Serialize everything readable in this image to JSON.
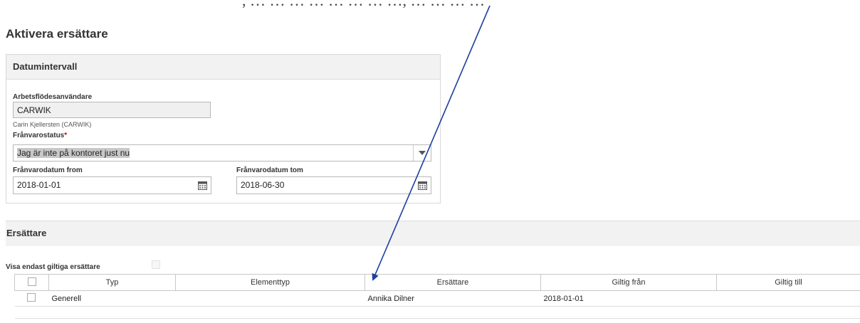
{
  "page": {
    "clipped_top_text": ", … … … … … … … …, …   … … …",
    "title": "Aktivera ersättare"
  },
  "datumintervall": {
    "header": "Datumintervall",
    "workflow_user_label": "Arbetsflödesanvändare",
    "workflow_user_value": "CARWIK",
    "workflow_user_name": "Carin Kjellersten (CARWIK)",
    "absence_status_label": "Frånvarostatus",
    "absence_status_required": "*",
    "absence_status_value": "Jag är inte på kontoret just nu",
    "date_from_label": "Frånvarodatum from",
    "date_from_value": "2018-01-01",
    "date_to_label": "Frånvarodatum tom",
    "date_to_value": "2018-06-30"
  },
  "ersattare": {
    "header": "Ersättare",
    "only_valid_label": "Visa endast giltiga ersättare",
    "columns": [
      "Typ",
      "Elementtyp",
      "Ersättare",
      "Giltig från",
      "Giltig till"
    ],
    "rows": [
      {
        "typ": "Generell",
        "elementtyp": "",
        "ersattare": "Annika Dilner",
        "giltig_fran": "2018-01-01",
        "giltig_till": ""
      }
    ]
  },
  "annotation": {
    "color": "#1f3fa0"
  }
}
